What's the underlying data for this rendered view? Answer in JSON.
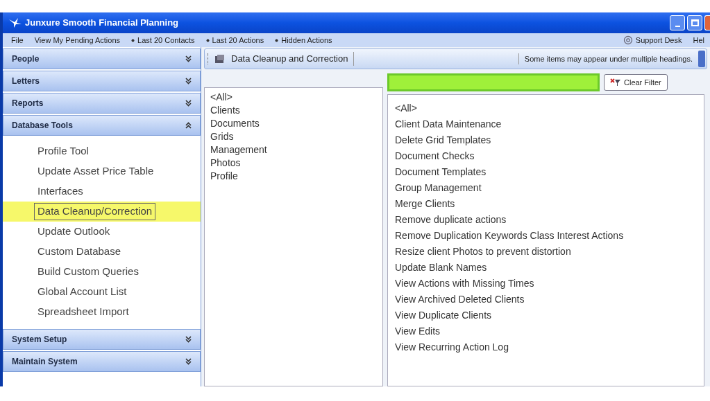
{
  "window": {
    "title": "Junxure Smooth Financial Planning"
  },
  "menu": [
    {
      "label": "File",
      "kind": "plain"
    },
    {
      "label": "View My Pending Actions",
      "kind": "plain"
    },
    {
      "label": "Last 20 Contacts",
      "kind": "dropdown"
    },
    {
      "label": "Last 20 Actions",
      "kind": "dropdown"
    },
    {
      "label": "Hidden Actions",
      "kind": "dropdown"
    },
    {
      "label": "Support Desk",
      "kind": "support"
    },
    {
      "label": "Hel",
      "kind": "plain"
    }
  ],
  "sidebar": [
    {
      "title": "People",
      "expanded": false
    },
    {
      "title": "Letters",
      "expanded": false
    },
    {
      "title": "Reports",
      "expanded": false
    },
    {
      "title": "Database Tools",
      "expanded": true,
      "items": [
        {
          "label": "Profile Tool",
          "selected": false
        },
        {
          "label": "Update Asset Price Table",
          "selected": false
        },
        {
          "label": "Interfaces",
          "selected": false
        },
        {
          "label": "Data Cleanup/Correction",
          "selected": true
        },
        {
          "label": "Update Outlook",
          "selected": false
        },
        {
          "label": "Custom Database",
          "selected": false
        },
        {
          "label": "Build Custom Queries",
          "selected": false
        },
        {
          "label": "Global Account List",
          "selected": false
        },
        {
          "label": "Spreadsheet Import",
          "selected": false
        }
      ]
    },
    {
      "title": "System Setup",
      "expanded": false
    },
    {
      "title": "Maintain System",
      "expanded": false
    }
  ],
  "toolbar": {
    "title": "Data Cleanup and Correction",
    "note": "Some items may appear under multiple headings."
  },
  "categories": [
    "<All>",
    "Clients",
    "Documents",
    "Grids",
    "Management",
    "Photos",
    "Profile"
  ],
  "filter": {
    "button": "Clear Filter"
  },
  "actions": [
    "<All>",
    "Client Data Maintenance",
    "Delete Grid Templates",
    "Document Checks",
    "Document Templates",
    "Group Management",
    "Merge Clients",
    "Remove duplicate actions",
    "Remove Duplication Keywords Class Interest Actions",
    "Resize client Photos to prevent distortion",
    "Update Blank Names",
    "View Actions with Missing Times",
    "View Archived Deleted Clients",
    "View Duplicate Clients",
    "View Edits",
    "View Recurring Action Log"
  ]
}
